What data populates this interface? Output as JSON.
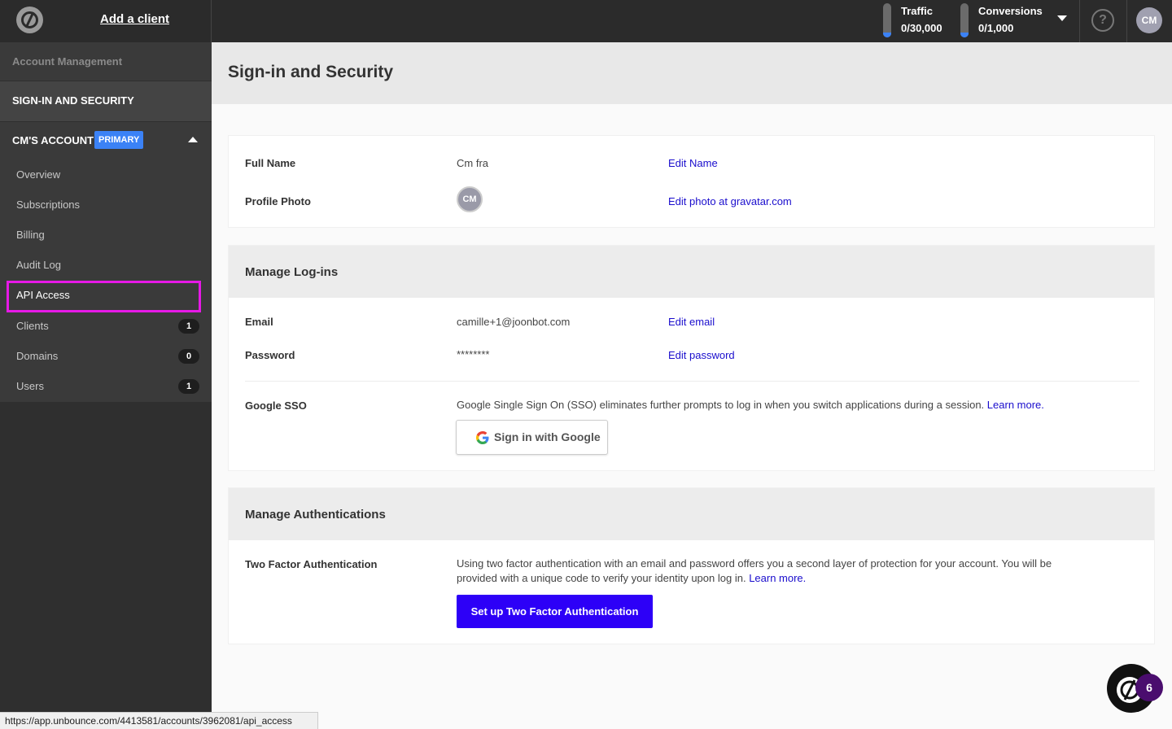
{
  "topbar": {
    "add_client": "Add a client",
    "traffic": {
      "label": "Traffic",
      "value": "0/30,000",
      "fill_fraction": 0.0
    },
    "conversions": {
      "label": "Conversions",
      "value": "0/1,000",
      "fill_fraction": 0.0
    },
    "help_glyph": "?",
    "avatar_initials": "CM"
  },
  "sidebar": {
    "heading": "Account Management",
    "signin_security": "SIGN-IN AND SECURITY",
    "account_label": "CM'S ACCOUNT",
    "primary_badge": "PRIMARY",
    "items": [
      {
        "label": "Overview"
      },
      {
        "label": "Subscriptions"
      },
      {
        "label": "Billing"
      },
      {
        "label": "Audit Log"
      },
      {
        "label": "API Access"
      },
      {
        "label": "Clients",
        "count": "1"
      },
      {
        "label": "Domains",
        "count": "0"
      },
      {
        "label": "Users",
        "count": "1"
      }
    ]
  },
  "status_url": "https://app.unbounce.com/4413581/accounts/3962081/api_access",
  "page": {
    "title": "Sign-in and Security",
    "profile": {
      "full_name_label": "Full Name",
      "full_name_value": "Cm fra",
      "edit_name": "Edit Name",
      "photo_label": "Profile Photo",
      "photo_initials": "CM",
      "edit_photo": "Edit photo at gravatar.com"
    },
    "logins": {
      "title": "Manage Log-ins",
      "email_label": "Email",
      "email_value": "camille+1@joonbot.com",
      "edit_email": "Edit email",
      "password_label": "Password",
      "password_value": "********",
      "edit_password": "Edit password",
      "sso_label": "Google SSO",
      "sso_text": "Google Single Sign On (SSO) eliminates further prompts to log in when you switch applications during a session.",
      "sso_learn_more": "Learn more.",
      "google_button": "Sign in with Google"
    },
    "auth": {
      "title": "Manage Authentications",
      "tfa_label": "Two Factor Authentication",
      "tfa_text": "Using two factor authentication with an email and password offers you a second layer of protection for your account. You will be provided with a unique code to verify your identity upon log in.",
      "tfa_learn_more": "Learn more.",
      "tfa_button": "Set up Two Factor Authentication"
    }
  },
  "chat": {
    "badge_count": "6"
  },
  "colors": {
    "topbar": "#2b2b2b",
    "sidebar": "#2f2f2f",
    "link": "#1a0dcd",
    "primary_button": "#2d00f7",
    "badge_primary": "#3b82f6",
    "highlight": "#e619e6"
  }
}
